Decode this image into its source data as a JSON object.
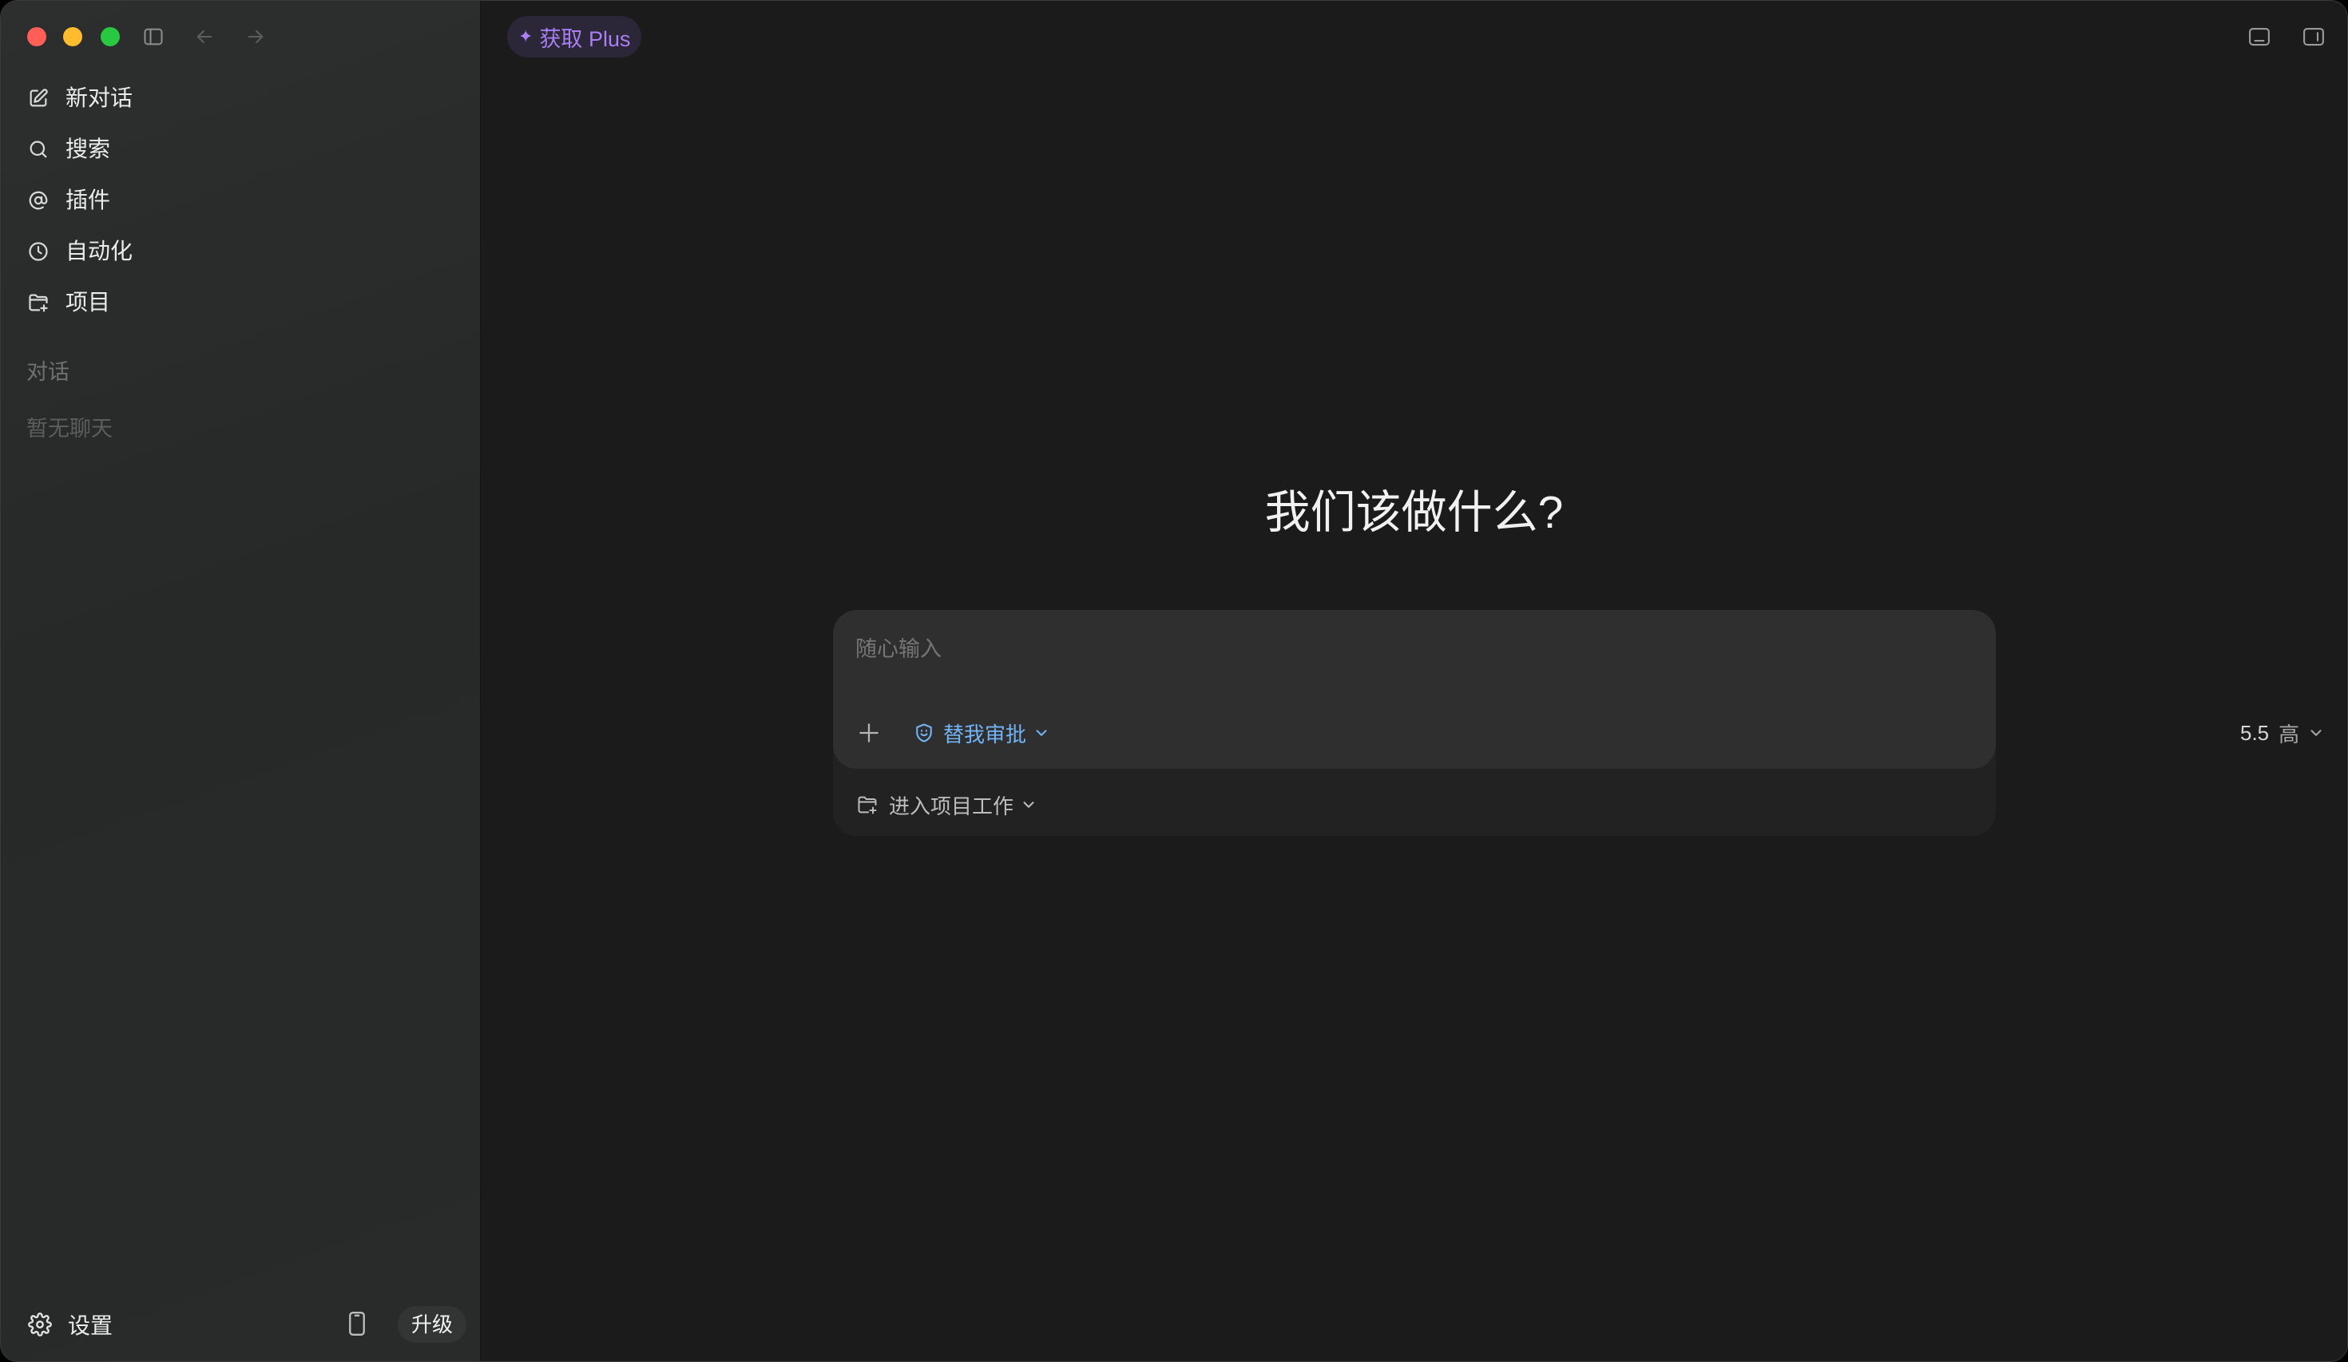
{
  "window": {
    "colors": {
      "close": "#ff5f57",
      "minimize": "#febc2e",
      "maximize": "#28c840"
    }
  },
  "toolbar": {
    "icons": [
      "sidebar-toggle-icon",
      "back-arrow-icon",
      "forward-arrow-icon"
    ]
  },
  "sidebar": {
    "items": [
      {
        "label": "新对话",
        "icon": "compose-icon"
      },
      {
        "label": "搜索",
        "icon": "search-icon"
      },
      {
        "label": "插件",
        "icon": "at-sign-icon"
      },
      {
        "label": "自动化",
        "icon": "clock-icon"
      },
      {
        "label": "项目",
        "icon": "folder-plus-icon"
      }
    ],
    "section_label": "对话",
    "empty_text": "暂无聊天",
    "settings_label": "设置",
    "settings_icon": "gear-icon",
    "phone_icon": "phone-icon",
    "upgrade_label": "升级"
  },
  "header": {
    "plus_glyph": "✦",
    "plus_label": "获取 Plus",
    "accent_color": "#a97ff2",
    "right_icons": [
      "bottom-panel-icon",
      "right-panel-icon"
    ]
  },
  "main": {
    "heading": "我们该做什么?"
  },
  "composer": {
    "placeholder": "随心输入",
    "value": "",
    "approval_label": "替我审批",
    "approval_color": "#72b4f5",
    "model_version": "5.5",
    "effort_label": "高",
    "project_label": "进入项目工作"
  }
}
